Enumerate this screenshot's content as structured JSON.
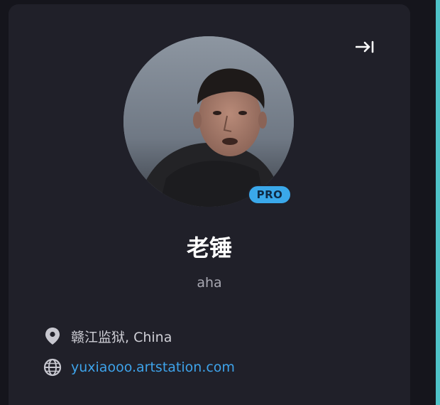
{
  "profile": {
    "name": "老锤",
    "tagline": "aha",
    "badge": "PRO",
    "location": "赣江监狱, China",
    "website": "yuxiaooo.artstation.com"
  },
  "icons": {
    "collapse": "collapse-panel-icon",
    "location": "map-pin-icon",
    "website": "globe-icon"
  },
  "colors": {
    "background": "#15151c",
    "card": "#202029",
    "accent_bar": "#4fc3c8",
    "badge": "#3aa8ea",
    "link": "#3ea3ea"
  }
}
